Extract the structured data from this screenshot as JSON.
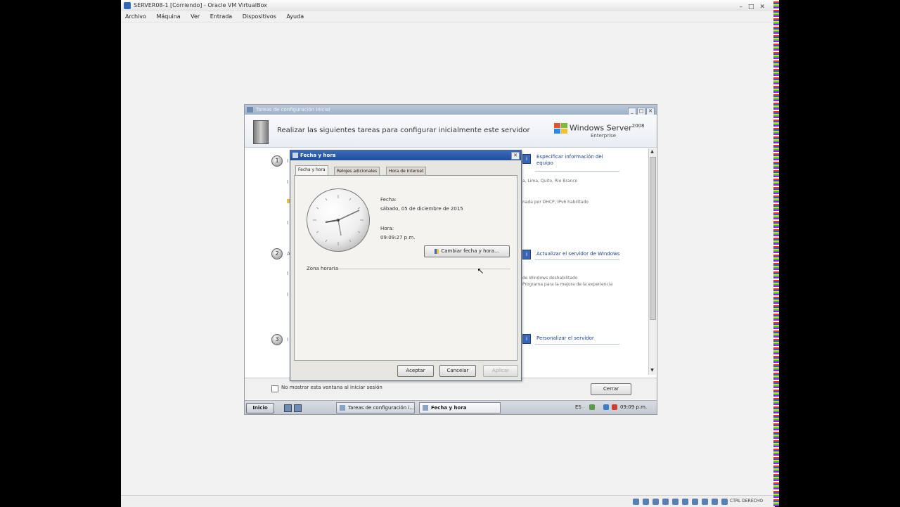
{
  "host": {
    "window_title": "SERVER08-1 [Corriendo] - Oracle VM VirtualBox",
    "menu": [
      "Archivo",
      "Máquina",
      "Ver",
      "Entrada",
      "Dispositivos",
      "Ayuda"
    ],
    "host_key": "CTRL DERECHO"
  },
  "itc": {
    "title": "Tareas de configuración inicial",
    "heading": "Realizar las siguientes tareas para configurar inicialmente este servidor",
    "logo_product": "Windows Server",
    "logo_year": "2008",
    "logo_edition": "Enterprise",
    "tasks": [
      {
        "label": "Especificar información del equipo",
        "number": "1"
      },
      {
        "label": "Actualizar el servidor de Windows",
        "number": "2"
      },
      {
        "label": "Personalizar el servidor",
        "number": "3"
      }
    ],
    "details": {
      "timezone": "a, Lima, Quito, Rio Branco",
      "network": "nada por DHCP, IPv6 habilitado",
      "updates_1": "de Windows deshabilitado",
      "updates_2": "Programa para la mejora de la experiencia"
    },
    "checkbox_label": "No mostrar esta ventana al iniciar sesión",
    "close_button": "Cerrar"
  },
  "dialog": {
    "title": "Fecha y hora",
    "tabs": [
      "Fecha y hora",
      "Relojes adicionales",
      "Hora de Internet"
    ],
    "fecha_label": "Fecha:",
    "fecha_value": "sábado, 05 de diciembre de 2015",
    "hora_label": "Hora:",
    "hora_value": "09:09:27 p.m.",
    "change_button": "Cambiar fecha y hora...",
    "zona_label": "Zona horaria",
    "ok_button": "Aceptar",
    "cancel_button": "Cancelar",
    "apply_button": "Aplicar"
  },
  "taskbar": {
    "start": "Inicio",
    "items": [
      "Tareas de configuración i...",
      "Fecha y hora"
    ],
    "lang": "ES",
    "time": "09:09 p.m."
  }
}
